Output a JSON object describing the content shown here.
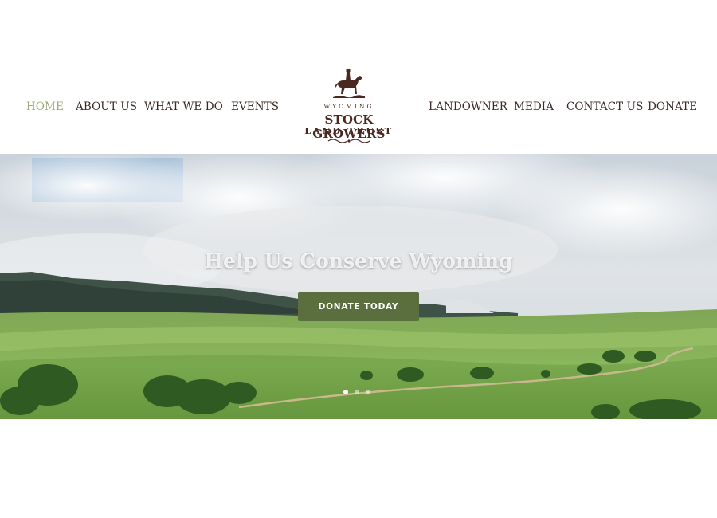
{
  "nav": {
    "left_items": [
      "HOME",
      "ABOUT US",
      "WHAT WE DO",
      "EVENTS"
    ],
    "right_items": [
      "LANDOWNER",
      "MEDIA",
      "CONTACT US",
      "DONATE"
    ],
    "active": "HOME"
  },
  "logo": {
    "state": "WYOMING",
    "line1": "STOCK GROWERS",
    "line2": "LAND TRUST"
  },
  "hero": {
    "title": "Help Us Conserve Wyoming",
    "button_label": "DONATE TODAY",
    "slides_total": 3,
    "slide_active": 1
  },
  "colors": {
    "nav_text": "#3b2a24",
    "nav_active": "#9bab74",
    "logo": "#4a2820",
    "button": "#5b6e3e"
  },
  "icons": {
    "logo_mark": "horse-rider-icon",
    "flourish": "ornament-icon"
  }
}
